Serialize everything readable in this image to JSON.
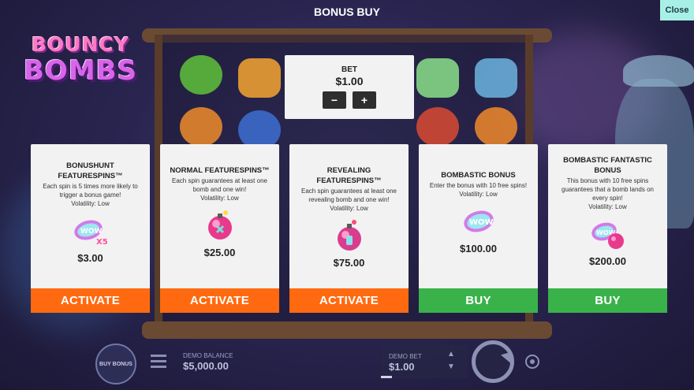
{
  "header": {
    "title": "BONUS BUY",
    "close_label": "Close"
  },
  "logo": {
    "line1": "BOUNCY",
    "line2": "BOMBS"
  },
  "bet": {
    "label": "BET",
    "value": "$1.00",
    "decrease_label": "−",
    "increase_label": "+"
  },
  "cards": [
    {
      "title": "BONUSHUNT FEATURESPINS™",
      "description": "Each spin is 5 times more likely to trigger a bonus game!",
      "volatility": "Volatility: Low",
      "icon": "wow-x5-icon",
      "price": "$3.00",
      "button_label": "ACTIVATE",
      "button_color": "#ff6a10"
    },
    {
      "title": "NORMAL FEATURESPINS™",
      "description": "Each spin guarantees at least one bomb and one win!",
      "volatility": "Volatility: Low",
      "icon": "pink-bomb-icon",
      "price": "$25.00",
      "button_label": "ACTIVATE",
      "button_color": "#ff6a10"
    },
    {
      "title": "REVEALING FEATURESPINS™",
      "description": "Each spin guarantees at least one revealing bomb and one win!",
      "volatility": "Volatility: Low",
      "icon": "revealing-bomb-icon",
      "price": "$75.00",
      "button_label": "ACTIVATE",
      "button_color": "#ff6a10"
    },
    {
      "title": "BOMBASTIC BONUS",
      "description": "Enter the bonus with 10 free spins!",
      "volatility": "Volatility: Low",
      "icon": "wow-icon",
      "price": "$100.00",
      "button_label": "BUY",
      "button_color": "#3ab24a"
    },
    {
      "title": "BOMBASTIC FANTASTIC BONUS",
      "description": "This bonus with 10 free spins guarantees that a bomb lands on every spin!",
      "volatility": "Volatility: Low",
      "icon": "wow-bomb-icon",
      "price": "$200.00",
      "button_label": "BUY",
      "button_color": "#3ab24a"
    }
  ],
  "footer": {
    "buy_bonus_label": "BUY BONUS",
    "demo_balance_label": "DEMO BALANCE",
    "demo_balance_value": "$5,000.00",
    "demo_bet_label": "DEMO BET",
    "demo_bet_value": "$1.00"
  },
  "colors": {
    "activate": "#ff6a10",
    "buy": "#3ab24a",
    "close_bg": "#a8f0e6"
  }
}
